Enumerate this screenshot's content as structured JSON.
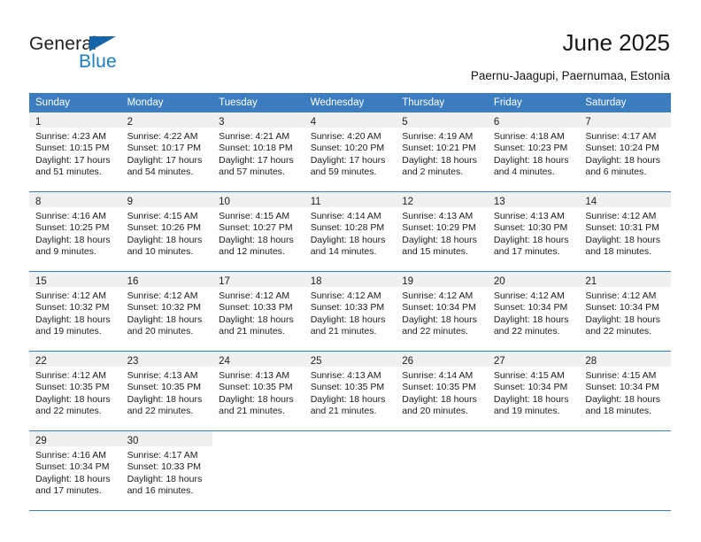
{
  "brand": {
    "name_part1": "General",
    "name_part2": "Blue",
    "logo_icon": "triangle-mark",
    "accent_color": "#1a7cc4"
  },
  "header": {
    "title": "June 2025",
    "subtitle": "Paernu-Jaagupi, Paernumaa, Estonia"
  },
  "calendar": {
    "header_bg": "#3b7dbf",
    "daynum_bg": "#f0f0f0",
    "weekdays": [
      "Sunday",
      "Monday",
      "Tuesday",
      "Wednesday",
      "Thursday",
      "Friday",
      "Saturday"
    ],
    "weeks": [
      [
        {
          "day": "1",
          "sunrise": "Sunrise: 4:23 AM",
          "sunset": "Sunset: 10:15 PM",
          "daylight": "Daylight: 17 hours and 51 minutes."
        },
        {
          "day": "2",
          "sunrise": "Sunrise: 4:22 AM",
          "sunset": "Sunset: 10:17 PM",
          "daylight": "Daylight: 17 hours and 54 minutes."
        },
        {
          "day": "3",
          "sunrise": "Sunrise: 4:21 AM",
          "sunset": "Sunset: 10:18 PM",
          "daylight": "Daylight: 17 hours and 57 minutes."
        },
        {
          "day": "4",
          "sunrise": "Sunrise: 4:20 AM",
          "sunset": "Sunset: 10:20 PM",
          "daylight": "Daylight: 17 hours and 59 minutes."
        },
        {
          "day": "5",
          "sunrise": "Sunrise: 4:19 AM",
          "sunset": "Sunset: 10:21 PM",
          "daylight": "Daylight: 18 hours and 2 minutes."
        },
        {
          "day": "6",
          "sunrise": "Sunrise: 4:18 AM",
          "sunset": "Sunset: 10:23 PM",
          "daylight": "Daylight: 18 hours and 4 minutes."
        },
        {
          "day": "7",
          "sunrise": "Sunrise: 4:17 AM",
          "sunset": "Sunset: 10:24 PM",
          "daylight": "Daylight: 18 hours and 6 minutes."
        }
      ],
      [
        {
          "day": "8",
          "sunrise": "Sunrise: 4:16 AM",
          "sunset": "Sunset: 10:25 PM",
          "daylight": "Daylight: 18 hours and 9 minutes."
        },
        {
          "day": "9",
          "sunrise": "Sunrise: 4:15 AM",
          "sunset": "Sunset: 10:26 PM",
          "daylight": "Daylight: 18 hours and 10 minutes."
        },
        {
          "day": "10",
          "sunrise": "Sunrise: 4:15 AM",
          "sunset": "Sunset: 10:27 PM",
          "daylight": "Daylight: 18 hours and 12 minutes."
        },
        {
          "day": "11",
          "sunrise": "Sunrise: 4:14 AM",
          "sunset": "Sunset: 10:28 PM",
          "daylight": "Daylight: 18 hours and 14 minutes."
        },
        {
          "day": "12",
          "sunrise": "Sunrise: 4:13 AM",
          "sunset": "Sunset: 10:29 PM",
          "daylight": "Daylight: 18 hours and 15 minutes."
        },
        {
          "day": "13",
          "sunrise": "Sunrise: 4:13 AM",
          "sunset": "Sunset: 10:30 PM",
          "daylight": "Daylight: 18 hours and 17 minutes."
        },
        {
          "day": "14",
          "sunrise": "Sunrise: 4:12 AM",
          "sunset": "Sunset: 10:31 PM",
          "daylight": "Daylight: 18 hours and 18 minutes."
        }
      ],
      [
        {
          "day": "15",
          "sunrise": "Sunrise: 4:12 AM",
          "sunset": "Sunset: 10:32 PM",
          "daylight": "Daylight: 18 hours and 19 minutes."
        },
        {
          "day": "16",
          "sunrise": "Sunrise: 4:12 AM",
          "sunset": "Sunset: 10:32 PM",
          "daylight": "Daylight: 18 hours and 20 minutes."
        },
        {
          "day": "17",
          "sunrise": "Sunrise: 4:12 AM",
          "sunset": "Sunset: 10:33 PM",
          "daylight": "Daylight: 18 hours and 21 minutes."
        },
        {
          "day": "18",
          "sunrise": "Sunrise: 4:12 AM",
          "sunset": "Sunset: 10:33 PM",
          "daylight": "Daylight: 18 hours and 21 minutes."
        },
        {
          "day": "19",
          "sunrise": "Sunrise: 4:12 AM",
          "sunset": "Sunset: 10:34 PM",
          "daylight": "Daylight: 18 hours and 22 minutes."
        },
        {
          "day": "20",
          "sunrise": "Sunrise: 4:12 AM",
          "sunset": "Sunset: 10:34 PM",
          "daylight": "Daylight: 18 hours and 22 minutes."
        },
        {
          "day": "21",
          "sunrise": "Sunrise: 4:12 AM",
          "sunset": "Sunset: 10:34 PM",
          "daylight": "Daylight: 18 hours and 22 minutes."
        }
      ],
      [
        {
          "day": "22",
          "sunrise": "Sunrise: 4:12 AM",
          "sunset": "Sunset: 10:35 PM",
          "daylight": "Daylight: 18 hours and 22 minutes."
        },
        {
          "day": "23",
          "sunrise": "Sunrise: 4:13 AM",
          "sunset": "Sunset: 10:35 PM",
          "daylight": "Daylight: 18 hours and 22 minutes."
        },
        {
          "day": "24",
          "sunrise": "Sunrise: 4:13 AM",
          "sunset": "Sunset: 10:35 PM",
          "daylight": "Daylight: 18 hours and 21 minutes."
        },
        {
          "day": "25",
          "sunrise": "Sunrise: 4:13 AM",
          "sunset": "Sunset: 10:35 PM",
          "daylight": "Daylight: 18 hours and 21 minutes."
        },
        {
          "day": "26",
          "sunrise": "Sunrise: 4:14 AM",
          "sunset": "Sunset: 10:35 PM",
          "daylight": "Daylight: 18 hours and 20 minutes."
        },
        {
          "day": "27",
          "sunrise": "Sunrise: 4:15 AM",
          "sunset": "Sunset: 10:34 PM",
          "daylight": "Daylight: 18 hours and 19 minutes."
        },
        {
          "day": "28",
          "sunrise": "Sunrise: 4:15 AM",
          "sunset": "Sunset: 10:34 PM",
          "daylight": "Daylight: 18 hours and 18 minutes."
        }
      ],
      [
        {
          "day": "29",
          "sunrise": "Sunrise: 4:16 AM",
          "sunset": "Sunset: 10:34 PM",
          "daylight": "Daylight: 18 hours and 17 minutes."
        },
        {
          "day": "30",
          "sunrise": "Sunrise: 4:17 AM",
          "sunset": "Sunset: 10:33 PM",
          "daylight": "Daylight: 18 hours and 16 minutes."
        },
        {
          "day": "",
          "sunrise": "",
          "sunset": "",
          "daylight": ""
        },
        {
          "day": "",
          "sunrise": "",
          "sunset": "",
          "daylight": ""
        },
        {
          "day": "",
          "sunrise": "",
          "sunset": "",
          "daylight": ""
        },
        {
          "day": "",
          "sunrise": "",
          "sunset": "",
          "daylight": ""
        },
        {
          "day": "",
          "sunrise": "",
          "sunset": "",
          "daylight": ""
        }
      ]
    ]
  }
}
